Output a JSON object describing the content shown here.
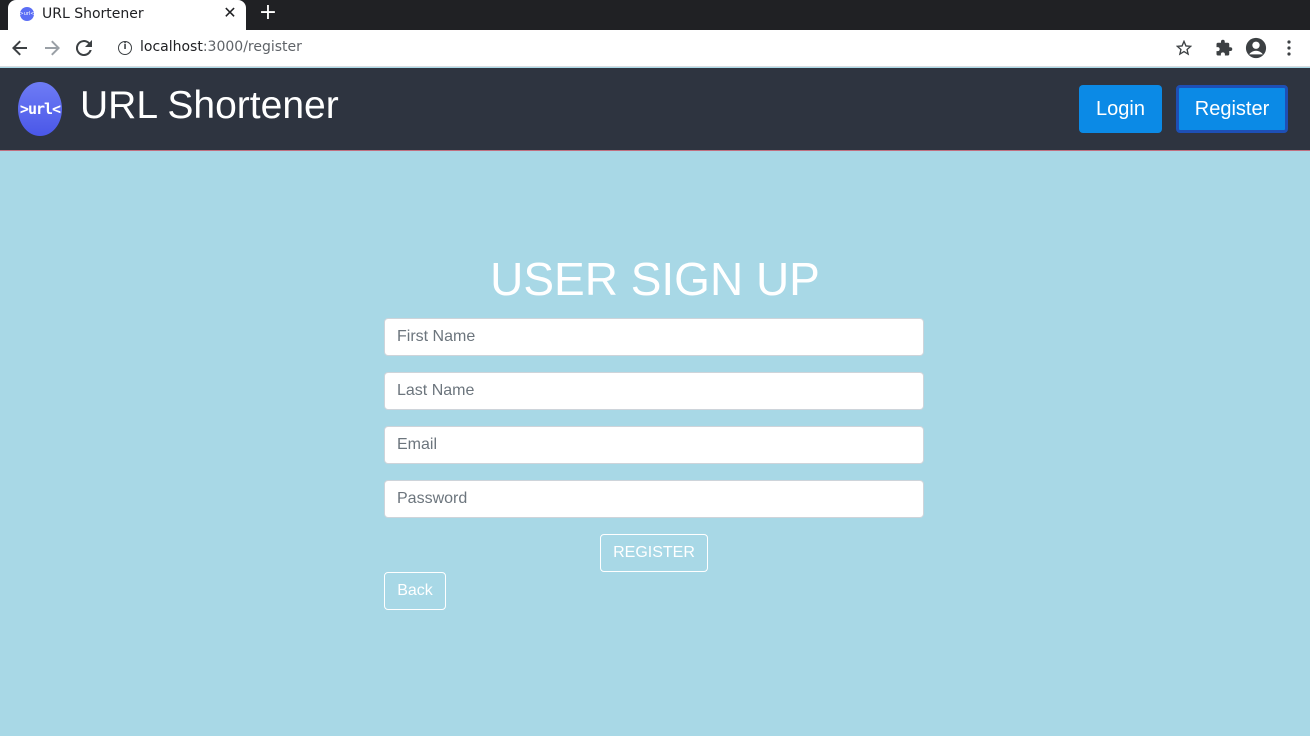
{
  "browser": {
    "tab_title": "URL Shortener",
    "favicon_text": ">url<",
    "close_glyph": "✕",
    "new_tab_glyph": "+",
    "url_host": "localhost",
    "url_path": ":3000/register",
    "icons": [
      "back-arrow-icon",
      "forward-arrow-icon",
      "reload-icon",
      "info-icon",
      "star-icon",
      "extensions-icon",
      "profile-icon",
      "menu-icon"
    ]
  },
  "header": {
    "logo_text": ">url<",
    "title": "URL Shortener",
    "login_label": "Login",
    "register_label": "Register"
  },
  "form": {
    "title": "USER SIGN UP",
    "first_name_placeholder": "First Name",
    "last_name_placeholder": "Last Name",
    "email_placeholder": "Email",
    "password_placeholder": "Password",
    "submit_label": "REGISTER",
    "back_label": "Back"
  },
  "colors": {
    "page_background": "#a8d8e6",
    "header_background": "#2e3440",
    "button_primary": "#0b8ae6",
    "logo_gradient": "#5b6ef5"
  }
}
